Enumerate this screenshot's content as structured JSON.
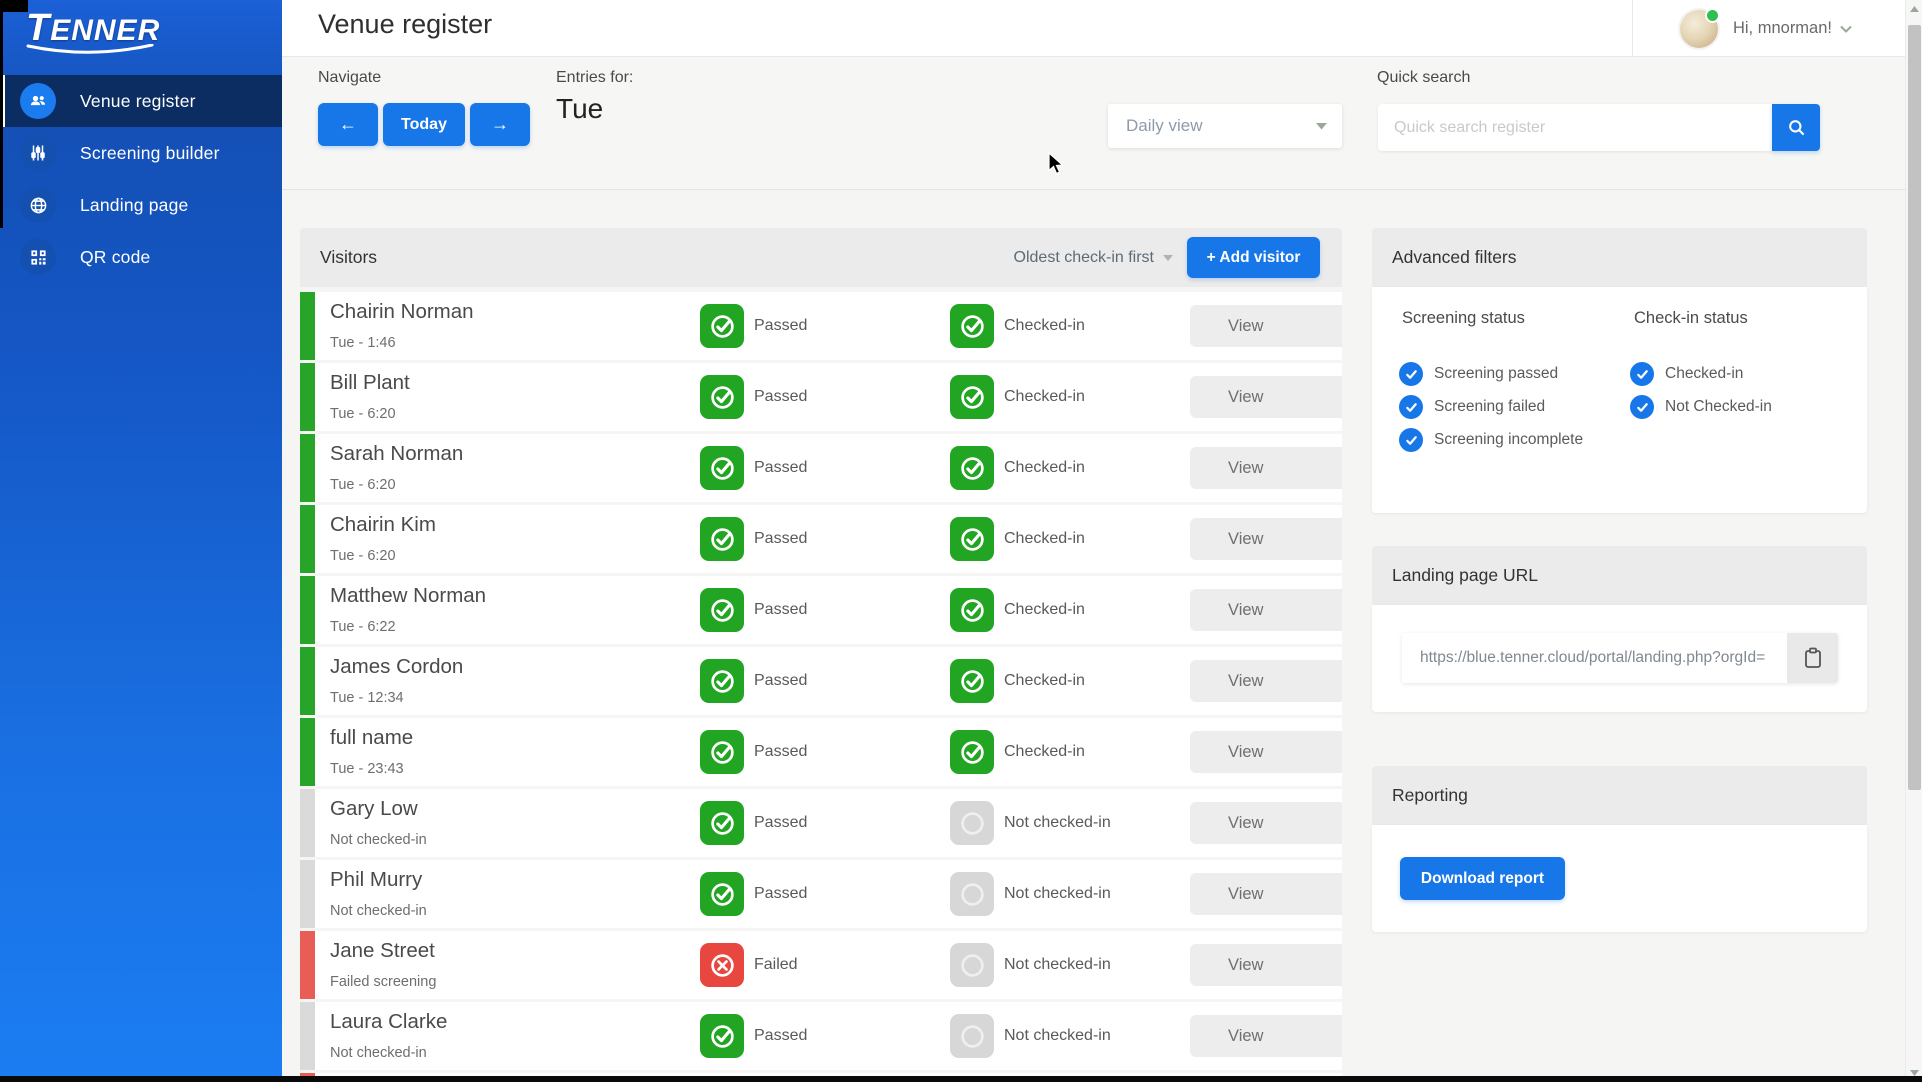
{
  "brand": {
    "logo_text": "TENNER"
  },
  "header": {
    "title": "Venue register",
    "greeting": "Hi, mnorman!"
  },
  "sidebar": {
    "items": [
      {
        "label": "Venue register",
        "icon": "people-icon",
        "active": true
      },
      {
        "label": "Screening builder",
        "icon": "sliders-icon",
        "active": false
      },
      {
        "label": "Landing page",
        "icon": "globe-icon",
        "active": false
      },
      {
        "label": "QR code",
        "icon": "qr-icon",
        "active": false
      }
    ]
  },
  "toolbar": {
    "navigate_label": "Navigate",
    "prev_label": "←",
    "today_label": "Today",
    "next_label": "→",
    "entries_for_label": "Entries for:",
    "entries_day": "Tue",
    "view_mode": "Daily view",
    "quick_search_label": "Quick search",
    "quick_search_placeholder": "Quick search register",
    "quick_search_value": ""
  },
  "visitors": {
    "title": "Visitors",
    "sort_label": "Oldest check-in first",
    "add_button_label": "+ Add visitor",
    "view_label": "View",
    "rows": [
      {
        "name": "Chairin Norman",
        "subtitle": "Tue - 1:46",
        "screening": "passed",
        "screening_label": "Passed",
        "checked_in": true,
        "checkin_label": "Checked-in",
        "bar": "green"
      },
      {
        "name": "Bill Plant",
        "subtitle": "Tue - 6:20",
        "screening": "passed",
        "screening_label": "Passed",
        "checked_in": true,
        "checkin_label": "Checked-in",
        "bar": "green"
      },
      {
        "name": "Sarah Norman",
        "subtitle": "Tue - 6:20",
        "screening": "passed",
        "screening_label": "Passed",
        "checked_in": true,
        "checkin_label": "Checked-in",
        "bar": "green"
      },
      {
        "name": "Chairin Kim",
        "subtitle": "Tue - 6:20",
        "screening": "passed",
        "screening_label": "Passed",
        "checked_in": true,
        "checkin_label": "Checked-in",
        "bar": "green"
      },
      {
        "name": "Matthew Norman",
        "subtitle": "Tue - 6:22",
        "screening": "passed",
        "screening_label": "Passed",
        "checked_in": true,
        "checkin_label": "Checked-in",
        "bar": "green"
      },
      {
        "name": "James Cordon",
        "subtitle": "Tue - 12:34",
        "screening": "passed",
        "screening_label": "Passed",
        "checked_in": true,
        "checkin_label": "Checked-in",
        "bar": "green"
      },
      {
        "name": "full name",
        "subtitle": "Tue - 23:43",
        "screening": "passed",
        "screening_label": "Passed",
        "checked_in": true,
        "checkin_label": "Checked-in",
        "bar": "green"
      },
      {
        "name": "Gary Low",
        "subtitle": "Not checked-in",
        "screening": "passed",
        "screening_label": "Passed",
        "checked_in": false,
        "checkin_label": "Not checked-in",
        "bar": "gray"
      },
      {
        "name": "Phil Murry",
        "subtitle": "Not checked-in",
        "screening": "passed",
        "screening_label": "Passed",
        "checked_in": false,
        "checkin_label": "Not checked-in",
        "bar": "gray"
      },
      {
        "name": "Jane Street",
        "subtitle": "Failed screening",
        "screening": "failed",
        "screening_label": "Failed",
        "checked_in": false,
        "checkin_label": "Not checked-in",
        "bar": "red"
      },
      {
        "name": "Laura Clarke",
        "subtitle": "Not checked-in",
        "screening": "passed",
        "screening_label": "Passed",
        "checked_in": false,
        "checkin_label": "Not checked-in",
        "bar": "gray"
      }
    ],
    "partial_row": {
      "bar": "red"
    }
  },
  "filters": {
    "title": "Advanced filters",
    "screening_title": "Screening status",
    "screening_options": [
      {
        "label": "Screening passed",
        "checked": true
      },
      {
        "label": "Screening failed",
        "checked": true
      },
      {
        "label": "Screening incomplete",
        "checked": true
      }
    ],
    "checkin_title": "Check-in status",
    "checkin_options": [
      {
        "label": "Checked-in",
        "checked": true
      },
      {
        "label": "Not Checked-in",
        "checked": true
      }
    ]
  },
  "landing_page": {
    "title": "Landing page URL",
    "url": "https://blue.tenner.cloud/portal/landing.php?orgId="
  },
  "reporting": {
    "title": "Reporting",
    "button_label": "Download report"
  },
  "colors": {
    "accent_blue": "#1877e8",
    "success_green": "#22a522",
    "danger_red": "#e8473f",
    "active_navy": "#0c2d62"
  }
}
